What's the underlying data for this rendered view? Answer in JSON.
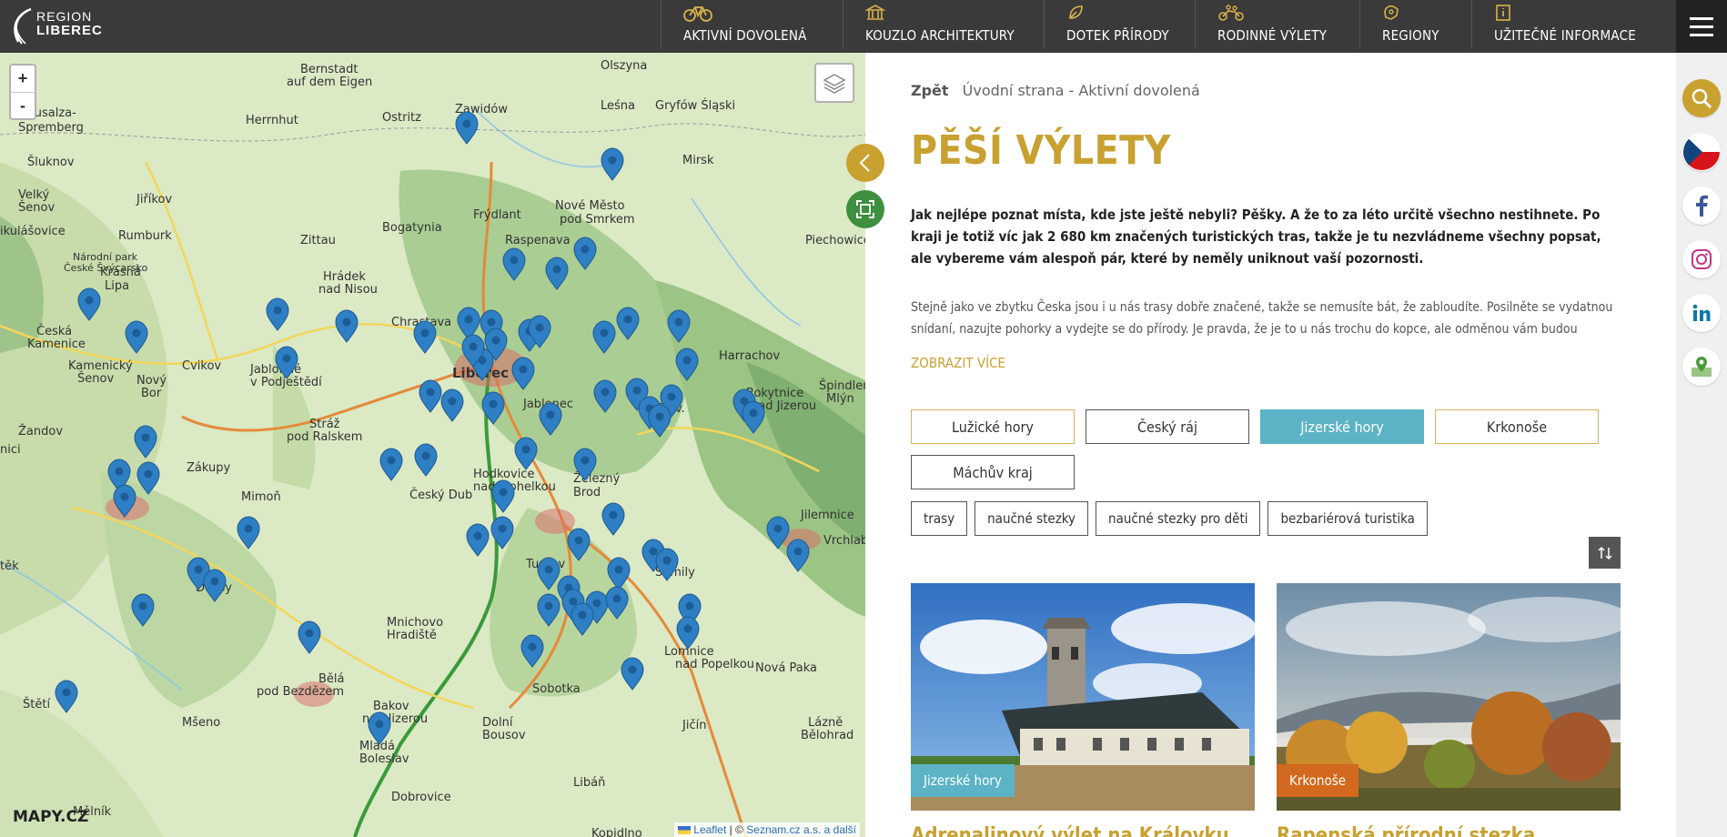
{
  "logo": {
    "line1": "REGION",
    "line2": "LIBEREC"
  },
  "nav": [
    {
      "label": "AKTIVNÍ DOVOLENÁ",
      "icon": "bicycle-icon"
    },
    {
      "label": "KOUZLO ARCHITEKTURY",
      "icon": "building-icon"
    },
    {
      "label": "DOTEK PŘÍRODY",
      "icon": "leaf-icon"
    },
    {
      "label": "RODINNÉ VÝLETY",
      "icon": "family-bike-icon"
    },
    {
      "label": "REGIONY",
      "icon": "region-icon"
    },
    {
      "label": "UŽITEČNÉ INFORMACE",
      "icon": "info-icon"
    }
  ],
  "map": {
    "zoom_in": "+",
    "zoom_out": "-",
    "brand": "MAPY.CZ",
    "attribution_leaflet": "Leaflet",
    "attribution_sep": " | © ",
    "attribution_rest": "Seznam.cz a.s. a další"
  },
  "content": {
    "back": "Zpět",
    "breadcrumb": "Úvodní strana - Aktivní dovolená",
    "title": "PĚŠÍ VÝLETY",
    "lead": "Jak nejlépe poznat místa, kde jste ještě nebyli? Pěšky. A že to za léto určitě všechno nestihnete. Po kraji je totiž víc jak 2 680 km značených turistických tras, takže je tu nezvládneme všechny popsat, ale vybereme vám alespoň pár, které by neměly uniknout vaší pozornosti.",
    "body": "Stejně jako ve zbytku Česka jsou i u nás trasy dobře značené, takže se nemusíte bát, že zabloudíte. Posilněte se vydatnou snídaní, nazujte pohorky a vydejte se do přírody. Je pravda, že je to u nás trochu do kopce, ale odměnou vám budou výhledy, dobrá kondička i…",
    "show_more": "ZOBRAZIT VÍCE",
    "regions": [
      "Lužické hory",
      "Český ráj",
      "Jizerské hory",
      "Krkonoše",
      "Máchův kraj"
    ],
    "active_region": "Jizerské hory",
    "tags": [
      "trasy",
      "naučné stezky",
      "naučné stezky pro děti",
      "bezbariérová turistika"
    ],
    "cards": [
      {
        "badge": "Jizerské hory",
        "badge_color": "#5bb3c5",
        "title": "Adrenalinový výlet na Královku"
      },
      {
        "badge": "Krkonoše",
        "badge_color": "#d2691e",
        "title": "Rapenská přírodní stezka"
      }
    ]
  },
  "colors": {
    "accent": "#c8a130",
    "topbar": "#3a3a3a",
    "active": "#5bb3c5",
    "pin": "#2f7fc4"
  }
}
